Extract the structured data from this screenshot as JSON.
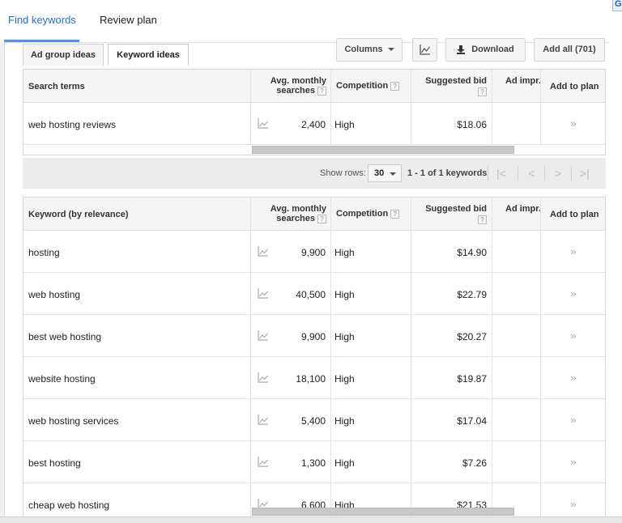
{
  "topnav": {
    "tabs": [
      {
        "label": "Find keywords",
        "active": true
      },
      {
        "label": "Review plan",
        "active": false
      }
    ]
  },
  "subtabs": {
    "ad_group_ideas": "Ad group ideas",
    "keyword_ideas": "Keyword ideas"
  },
  "toolbar": {
    "columns_label": "Columns",
    "download_label": "Download",
    "add_all_label": "Add all (701)"
  },
  "columns": {
    "avg_monthly_line1": "Avg. monthly",
    "avg_monthly_line2": "searches",
    "competition": "Competition",
    "suggested_bid": "Suggested bid",
    "ad_impr": "Ad impr.",
    "add_to_plan": "Add to plan",
    "help_mark": "?"
  },
  "search_terms_table": {
    "header": "Search terms",
    "rows": [
      {
        "keyword": "web hosting reviews",
        "searches": "2,400",
        "competition": "High",
        "bid": "$18.06",
        "add": "»"
      }
    ]
  },
  "pagination": {
    "show_rows_label": "Show rows:",
    "rows_value": "30",
    "range_label": "1 - 1 of 1 keywords",
    "first": "|<",
    "prev": "<",
    "next": ">",
    "last": ">|"
  },
  "keyword_table": {
    "header": "Keyword (by relevance)",
    "rows": [
      {
        "keyword": "hosting",
        "searches": "9,900",
        "competition": "High",
        "bid": "$14.90",
        "add": "»"
      },
      {
        "keyword": "web hosting",
        "searches": "40,500",
        "competition": "High",
        "bid": "$22.79",
        "add": "»"
      },
      {
        "keyword": "best web hosting",
        "searches": "9,900",
        "competition": "High",
        "bid": "$20.27",
        "add": "»"
      },
      {
        "keyword": "website hosting",
        "searches": "18,100",
        "competition": "High",
        "bid": "$19.87",
        "add": "»"
      },
      {
        "keyword": "web hosting services",
        "searches": "5,400",
        "competition": "High",
        "bid": "$17.04",
        "add": "»"
      },
      {
        "keyword": "best hosting",
        "searches": "1,300",
        "competition": "High",
        "bid": "$7.26",
        "add": "»"
      },
      {
        "keyword": "cheap web hosting",
        "searches": "6,600",
        "competition": "High",
        "bid": "$21.53",
        "add": "»"
      }
    ]
  },
  "icons": {
    "trend": "line-chart-icon",
    "download": "download-icon",
    "corner": "help-icon"
  },
  "corner_badge": "G",
  "colors": {
    "active_tab": "#1a73c8",
    "tab_underline": "#4d90fe"
  }
}
